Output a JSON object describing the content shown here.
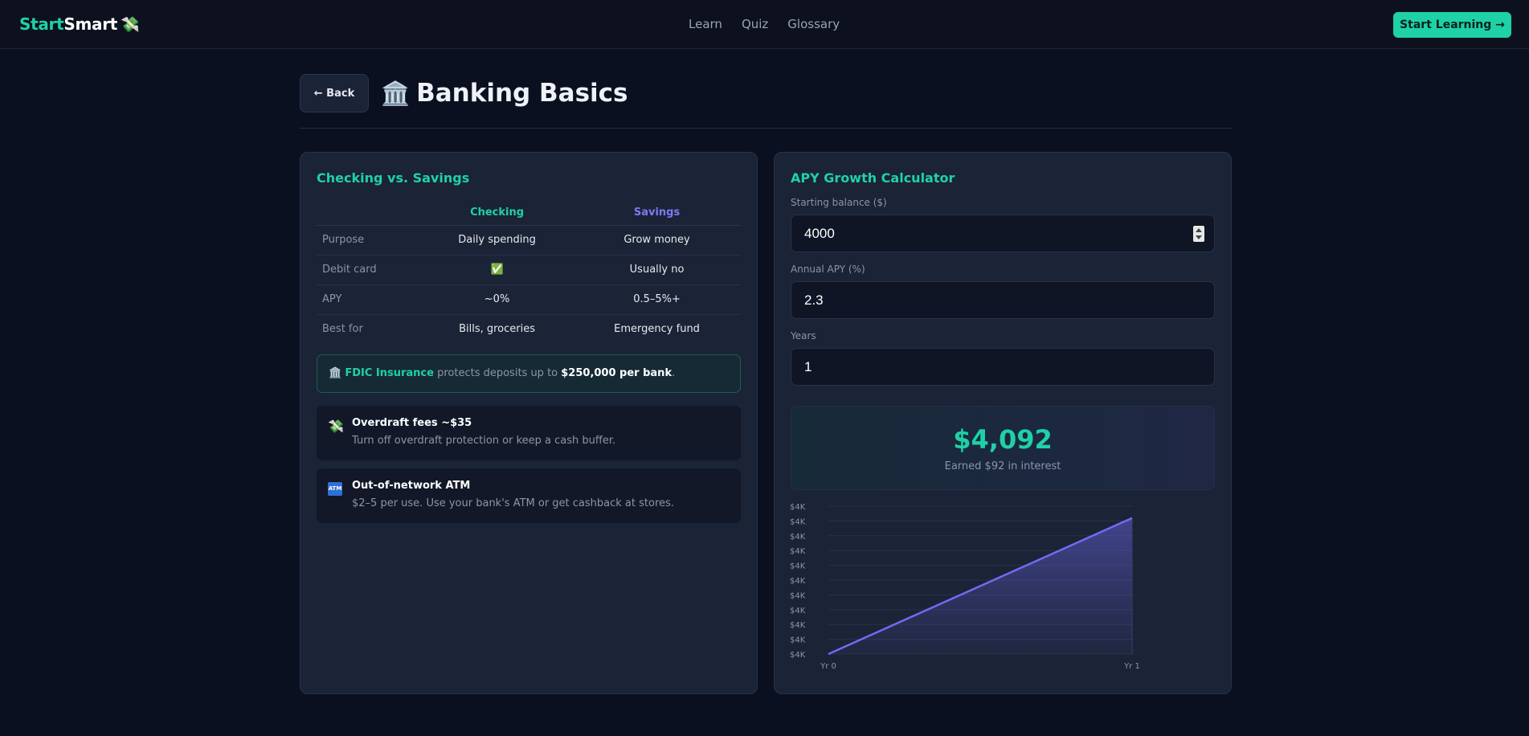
{
  "header": {
    "logo_part1": "Start",
    "logo_part2": "Smart",
    "logo_emoji": "💸",
    "nav": [
      "Learn",
      "Quiz",
      "Glossary"
    ],
    "cta_label": "Start Learning →"
  },
  "page": {
    "back_label": "← Back",
    "title_icon": "🏛️",
    "title": "Banking Basics"
  },
  "compare": {
    "title": "Checking vs. Savings",
    "columns": [
      "Checking",
      "Savings"
    ],
    "rows": [
      {
        "label": "Purpose",
        "checking": "Daily spending",
        "savings": "Grow money"
      },
      {
        "label": "Debit card",
        "checking": "✅",
        "savings": "Usually no"
      },
      {
        "label": "APY",
        "checking": "~0%",
        "savings": "0.5–5%+"
      },
      {
        "label": "Best for",
        "checking": "Bills, groceries",
        "savings": "Emergency fund"
      }
    ],
    "fdic": {
      "icon": "🏛️",
      "highlight": "FDIC Insurance",
      "text": "protects deposits up to",
      "strong": "$250,000 per bank",
      "end": "."
    },
    "tips": [
      {
        "icon": "💸",
        "title": "Overdraft fees ~$35",
        "desc": "Turn off overdraft protection or keep a cash buffer."
      },
      {
        "icon": "ATM",
        "title": "Out-of-network ATM",
        "desc": "$2–5 per use. Use your bank's ATM or get cashback at stores."
      }
    ]
  },
  "calculator": {
    "title": "APY Growth Calculator",
    "balance_label": "Starting balance ($)",
    "balance_value": "4000",
    "apy_label": "Annual APY (%)",
    "apy_value": "2.3",
    "years_label": "Years",
    "years_value": "1",
    "result_value": "$4,092",
    "result_sub": "Earned $92 in interest"
  },
  "colors": {
    "accent": "#1fd1a6",
    "savings": "#7b7bf5",
    "line": "#6f6cf2"
  },
  "chart_data": {
    "type": "area",
    "x": [
      "Yr 0",
      "Yr 1"
    ],
    "series": [
      {
        "values": [
          4000,
          4092
        ]
      }
    ],
    "ylim": [
      4000,
      4100
    ],
    "y_tick_labels": [
      "$4K",
      "$4K",
      "$4K",
      "$4K",
      "$4K",
      "$4K",
      "$4K",
      "$4K",
      "$4K",
      "$4K",
      "$4K"
    ],
    "grid": true
  }
}
